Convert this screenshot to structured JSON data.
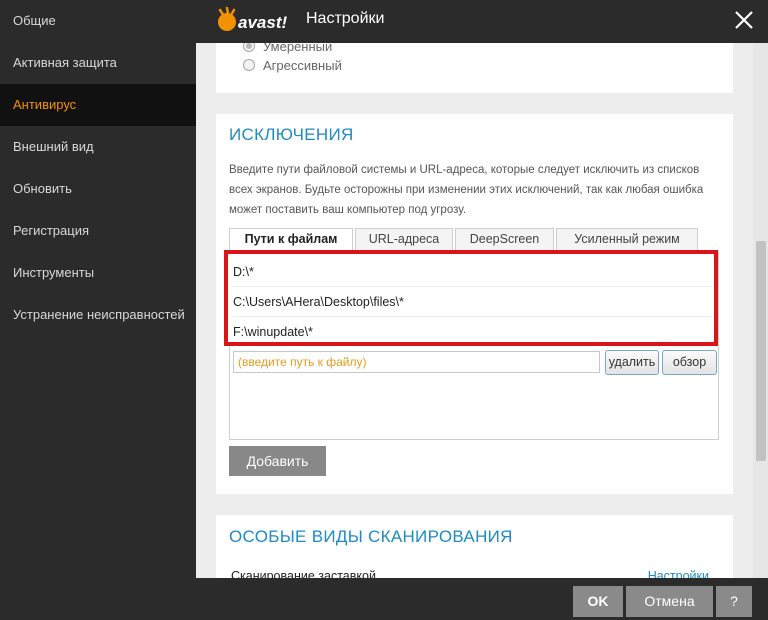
{
  "sidebar": {
    "items": [
      {
        "label": "Общие"
      },
      {
        "label": "Активная защита"
      },
      {
        "label": "Антивирус"
      },
      {
        "label": "Внешний вид"
      },
      {
        "label": "Обновить"
      },
      {
        "label": "Регистрация"
      },
      {
        "label": "Инструменты"
      },
      {
        "label": "Устранение неисправностей"
      }
    ],
    "active_index": 2
  },
  "header": {
    "logo_text": "avast!",
    "title": "Настройки"
  },
  "sensitivity": {
    "options": [
      "Умеренный",
      "Агрессивный"
    ],
    "selected": "Умеренный"
  },
  "exclusions": {
    "title": "ИСКЛЮЧЕНИЯ",
    "description": "Введите пути файловой системы и URL-адреса, которые следует исключить из списков всех экранов. Будьте осторожны при изменении этих исключений, так как любая ошибка может поставить ваш компьютер под угрозу.",
    "tabs": [
      "Пути к файлам",
      "URL-адреса",
      "DeepScreen",
      "Усиленный режим"
    ],
    "active_tab": "Пути к файлам",
    "paths": [
      "D:\\*",
      "C:\\Users\\AHera\\Desktop\\files\\*",
      "F:\\winupdate\\*"
    ],
    "input_placeholder": "(введите путь к файлу)",
    "delete_label": "удалить",
    "browse_label": "обзор",
    "add_label": "Добавить"
  },
  "special_scans": {
    "title": "ОСОБЫЕ ВИДЫ СКАНИРОВАНИЯ",
    "row_label": "Сканирование заставкой",
    "row_link": "Настройки"
  },
  "footer": {
    "ok_label": "OK",
    "cancel_label": "Отмена",
    "help_label": "?"
  },
  "colors": {
    "accent_orange": "#f39200",
    "link_blue": "#1e8bc3",
    "highlight_red": "#d9151b"
  }
}
